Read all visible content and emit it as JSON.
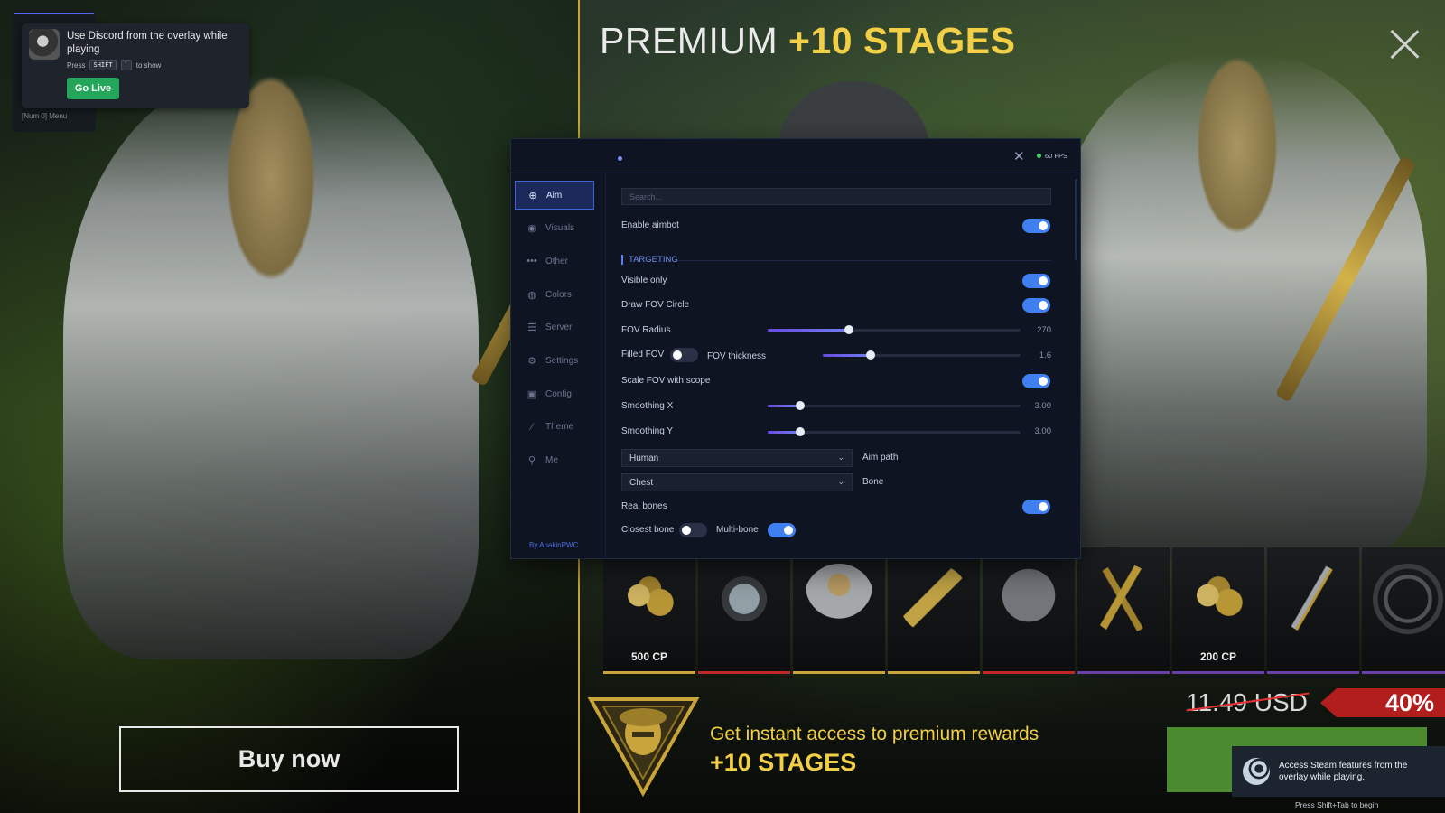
{
  "discord": {
    "message": "Use Discord from the overlay while playing",
    "hint_press": "Press",
    "hint_key1": "SHIFT",
    "hint_key2": "`",
    "hint_suffix": "to show",
    "go_live": "Go Live",
    "menu_hint": "[Num 0] Menu"
  },
  "left": {
    "buy_now": "Buy now"
  },
  "header": {
    "title_plain": "PREMIUM",
    "title_highlight": "+10 STAGES"
  },
  "rewards": [
    {
      "caption": "500 CP",
      "underline": "#c9a43a",
      "icon": "cp-coins"
    },
    {
      "caption": "",
      "underline": "#c0282a",
      "icon": "watch"
    },
    {
      "caption": "",
      "underline": "#c9a43a",
      "icon": "character"
    },
    {
      "caption": "",
      "underline": "#c9a43a",
      "icon": "gold-smg"
    },
    {
      "caption": "",
      "underline": "#c0282a",
      "icon": "outfit"
    },
    {
      "caption": "",
      "underline": "#6a3fa8",
      "icon": "gold-knives"
    },
    {
      "caption": "200 CP",
      "underline": "#6a3fa8",
      "icon": "cp-coins"
    },
    {
      "caption": "",
      "underline": "#6a3fa8",
      "icon": "katana"
    },
    {
      "caption": "",
      "underline": "#6a3fa8",
      "icon": "badge"
    }
  ],
  "promo": {
    "line1": "Get instant access to premium rewards",
    "line2": "+10 STAGES",
    "old_price": "11.49 USD",
    "discount": "40%"
  },
  "steam": {
    "message": "Access Steam features from the overlay while playing.",
    "hint": "Press Shift+Tab to begin"
  },
  "menu": {
    "fps": "60 FPS",
    "search_placeholder": "Search...",
    "byline": "By AnakinPWC",
    "nav": [
      {
        "label": "Aim",
        "icon": "crosshair-icon",
        "glyph": "⊕",
        "active": true
      },
      {
        "label": "Visuals",
        "icon": "eye-icon",
        "glyph": "◉",
        "active": false
      },
      {
        "label": "Other",
        "icon": "dots-icon",
        "glyph": "•••",
        "active": false
      },
      {
        "label": "Colors",
        "icon": "palette-icon",
        "glyph": "◍",
        "active": false
      },
      {
        "label": "Server",
        "icon": "server-icon",
        "glyph": "☰",
        "active": false
      },
      {
        "label": "Settings",
        "icon": "gear-icon",
        "glyph": "⚙",
        "active": false
      },
      {
        "label": "Config",
        "icon": "save-icon",
        "glyph": "▣",
        "active": false
      },
      {
        "label": "Theme",
        "icon": "brush-icon",
        "glyph": "⁄",
        "active": false
      },
      {
        "label": "Me",
        "icon": "user-icon",
        "glyph": "⚲",
        "active": false
      }
    ],
    "enable_aimbot": {
      "label": "Enable aimbot",
      "on": true
    },
    "section_targeting": "TARGETING",
    "visible_only": {
      "label": "Visible only",
      "on": true
    },
    "draw_fov_circle": {
      "label": "Draw FOV Circle",
      "on": true
    },
    "fov_radius": {
      "label": "FOV Radius",
      "value": "270",
      "fraction": 0.32
    },
    "filled_fov": {
      "label": "Filled FOV",
      "on": false
    },
    "fov_thickness": {
      "label": "FOV thickness",
      "value": "1.6",
      "fraction": 0.24
    },
    "scale_fov_scope": {
      "label": "Scale FOV with scope",
      "on": true
    },
    "smoothing_x": {
      "label": "Smoothing X",
      "value": "3.00",
      "fraction": 0.13
    },
    "smoothing_y": {
      "label": "Smoothing Y",
      "value": "3.00",
      "fraction": 0.13
    },
    "aim_path": {
      "selected": "Human",
      "label": "Aim path"
    },
    "bone": {
      "selected": "Chest",
      "label": "Bone"
    },
    "real_bones": {
      "label": "Real bones",
      "on": true
    },
    "closest_bone": {
      "label": "Closest bone",
      "on": false
    },
    "multi_bone": {
      "label": "Multi-bone",
      "on": true
    }
  }
}
